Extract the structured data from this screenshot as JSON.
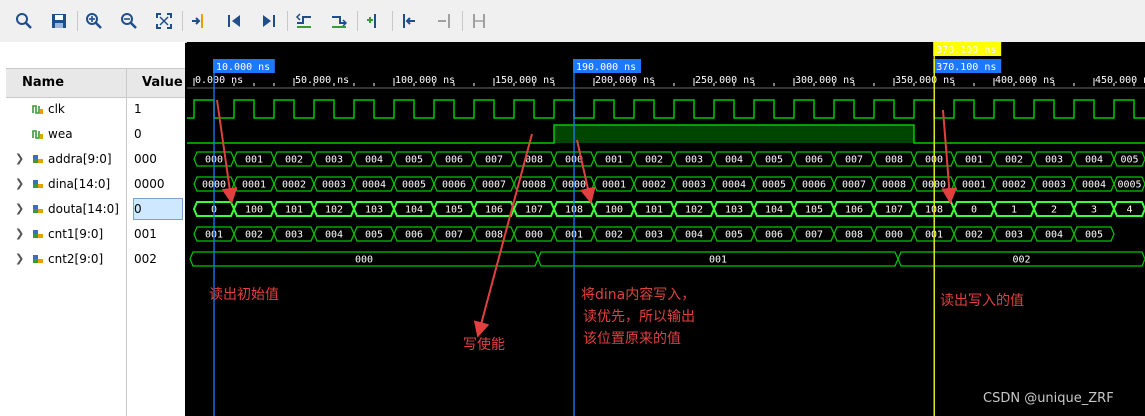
{
  "toolbar": {
    "buttons": [
      {
        "name": "zoom-fit-icon",
        "kind": "search"
      },
      {
        "name": "save-icon",
        "kind": "save"
      },
      {
        "name": "zoom-in-icon",
        "kind": "zoomin"
      },
      {
        "name": "zoom-out-icon",
        "kind": "zoomout"
      },
      {
        "name": "full-view-icon",
        "kind": "full"
      },
      {
        "name": "go-to-cursor-icon",
        "kind": "cursor"
      },
      {
        "name": "go-to-time-zero-icon",
        "kind": "start"
      },
      {
        "name": "go-to-last-time-icon",
        "kind": "end"
      },
      {
        "name": "previous-transition-icon",
        "kind": "prevtr"
      },
      {
        "name": "next-transition-icon",
        "kind": "nexttr"
      },
      {
        "name": "add-marker-icon",
        "kind": "addmark"
      },
      {
        "name": "previous-marker-icon",
        "kind": "prevmark"
      },
      {
        "name": "next-marker-icon",
        "kind": "nextmark"
      },
      {
        "name": "swap-cursors-icon",
        "kind": "swap"
      }
    ]
  },
  "signals_pane": {
    "name_header": "Name",
    "value_header": "Value",
    "signals": [
      {
        "name": "clk",
        "value": "1",
        "expandable": false,
        "icon": "bit-signal-icon"
      },
      {
        "name": "wea",
        "value": "0",
        "expandable": false,
        "icon": "bit-signal-icon"
      },
      {
        "name": "addra[9:0]",
        "value": "000",
        "expandable": true,
        "icon": "bus-signal-icon"
      },
      {
        "name": "dina[14:0]",
        "value": "0000",
        "expandable": true,
        "icon": "bus-signal-icon"
      },
      {
        "name": "douta[14:0]",
        "value": "0",
        "expandable": true,
        "icon": "bus-signal-icon",
        "selected": true
      },
      {
        "name": "cnt1[9:0]",
        "value": "001",
        "expandable": true,
        "icon": "bus-signal-icon"
      },
      {
        "name": "cnt2[9:0]",
        "value": "002",
        "expandable": true,
        "icon": "bus-signal-icon"
      }
    ]
  },
  "timeline": {
    "tick_labels": [
      "0.000 ns",
      "50.000 ns",
      "100.000 ns",
      "150.000 ns",
      "200.000 ns",
      "250.000 ns",
      "300.000 ns",
      "350.000 ns",
      "400.000 ns",
      "450.000 ns"
    ],
    "cursor_labels": [
      "10.000 ns",
      "190.000 ns",
      "370.100 ns",
      "370.100 ns"
    ]
  },
  "colors": {
    "wave": "#00c800",
    "cursor_blue": "#1e78ff",
    "cursor_yellow": "#ffff00",
    "annotation": "#e04040"
  },
  "waveforms": {
    "clk": "clock",
    "wea": "high",
    "addra": [
      "000",
      "001",
      "002",
      "003",
      "004",
      "005",
      "006",
      "007",
      "008",
      "000",
      "001",
      "002",
      "003",
      "004",
      "005",
      "006",
      "007",
      "008",
      "000",
      "001",
      "002",
      "003",
      "004",
      "005"
    ],
    "dina": [
      "0000",
      "0001",
      "0002",
      "0003",
      "0004",
      "0005",
      "0006",
      "0007",
      "0008",
      "0000",
      "0001",
      "0002",
      "0003",
      "0004",
      "0005",
      "0006",
      "0007",
      "0008",
      "0000",
      "0001",
      "0002",
      "0003",
      "0004",
      "0005"
    ],
    "douta": [
      "0",
      "100",
      "101",
      "102",
      "103",
      "104",
      "105",
      "106",
      "107",
      "108",
      "100",
      "101",
      "102",
      "103",
      "104",
      "105",
      "106",
      "107",
      "108",
      "0",
      "1",
      "2",
      "3",
      "4"
    ],
    "cnt1": [
      "001",
      "002",
      "003",
      "004",
      "005",
      "006",
      "007",
      "008",
      "000",
      "001",
      "002",
      "003",
      "004",
      "005",
      "006",
      "007",
      "008",
      "000",
      "001",
      "002",
      "003",
      "004",
      "005"
    ],
    "cnt2": [
      "000",
      "001",
      "002"
    ]
  },
  "annotations": {
    "read_initial": "读出初始值",
    "write_enable": "写使能",
    "write_line1": "将dina内容写入，",
    "write_line2": "读优先，所以输出",
    "write_line3": "该位置原来的值",
    "read_written": "读出写入的值"
  },
  "watermark": "CSDN @unique_ZRF"
}
